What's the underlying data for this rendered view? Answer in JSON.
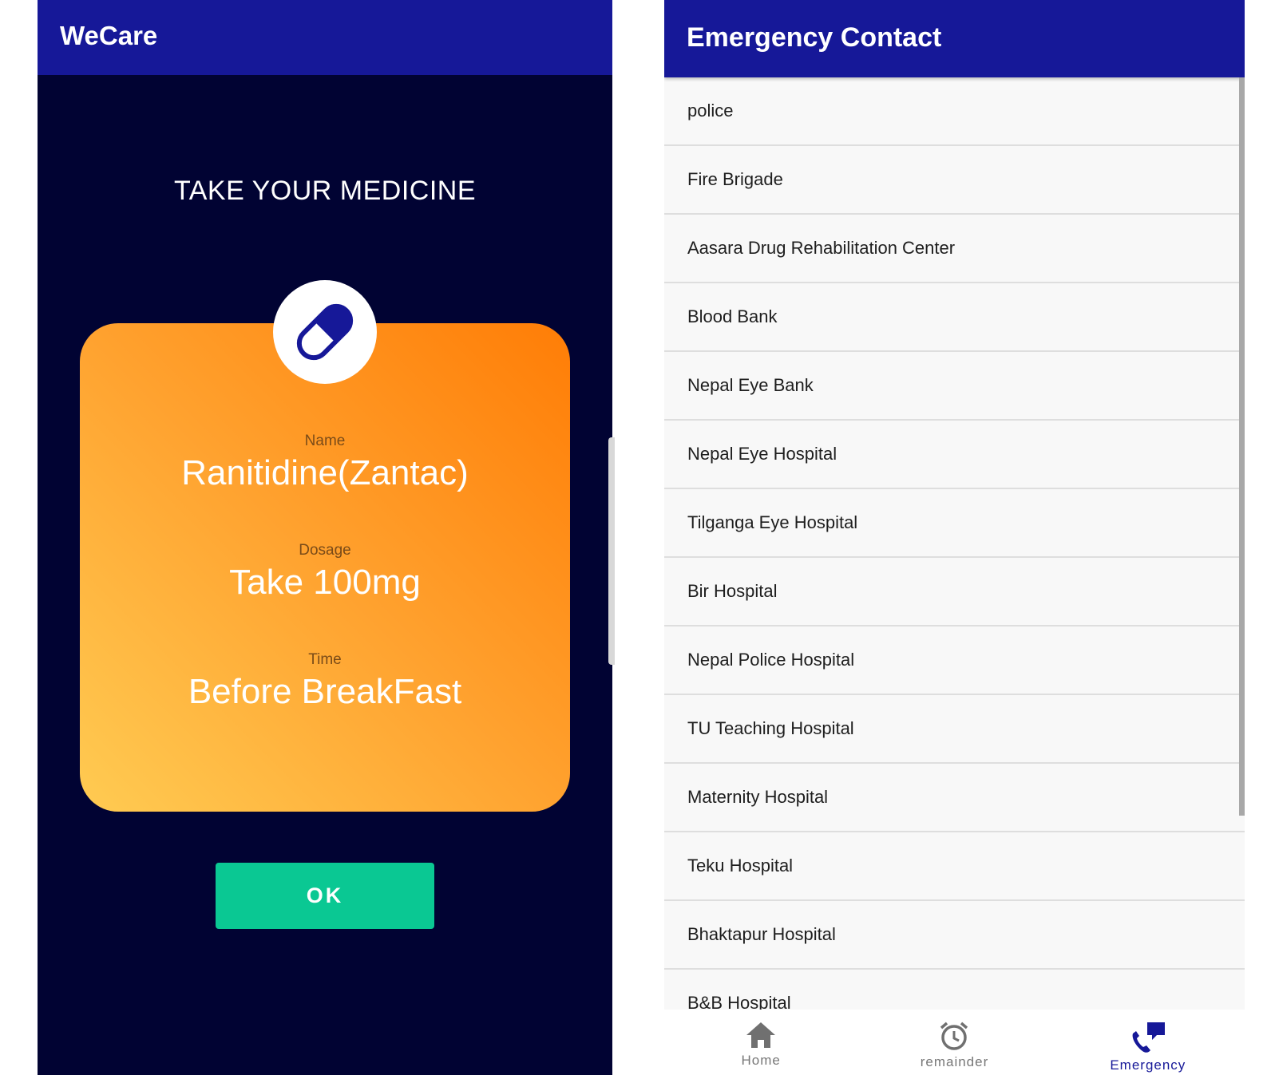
{
  "left_screen": {
    "app_title": "WeCare",
    "heading": "TAKE YOUR MEDICINE",
    "pill_icon": "pill-capsule-icon",
    "fields": {
      "name_label": "Name",
      "name_value": "Ranitidine(Zantac)",
      "dosage_label": "Dosage",
      "dosage_value": "Take 100mg",
      "time_label": "Time",
      "time_value": "Before BreakFast"
    },
    "ok_label": "OK"
  },
  "right_screen": {
    "title": "Emergency Contact",
    "contacts": [
      "police",
      "Fire Brigade",
      "Aasara Drug Rehabilitation Center",
      "Blood Bank",
      "Nepal Eye Bank",
      "Nepal Eye Hospital",
      "Tilganga Eye Hospital",
      "Bir Hospital",
      "Nepal Police Hospital",
      "TU Teaching Hospital",
      "Maternity Hospital",
      "Teku Hospital",
      "Bhaktapur Hospital",
      "B&B Hospital"
    ],
    "nav": {
      "home_label": "Home",
      "home_icon": "home-icon",
      "remainder_label": "remainder",
      "remainder_icon": "alarm-clock-icon",
      "emergency_label": "Emergency",
      "emergency_icon": "phone-chat-icon"
    }
  },
  "colors": {
    "app_bar": "#161898",
    "left_background": "#010333",
    "card_orange": "#ff7d06",
    "card_yellow": "#ffcb52",
    "ok_button": "#0ac893",
    "list_background": "#f8f8f8"
  }
}
